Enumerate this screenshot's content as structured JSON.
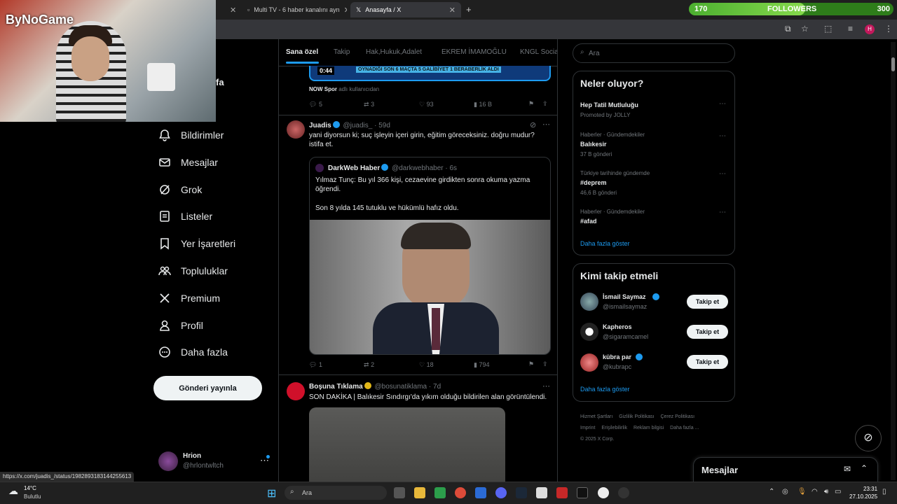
{
  "browser": {
    "tabs": [
      {
        "label": ""
      },
      {
        "label": "Multi TV - 6 haber kanalını ayn"
      },
      {
        "label": "Anasayfa / X"
      }
    ],
    "status_url": "https://x.com/juadis_/status/1982893183144255613"
  },
  "overlay": {
    "logo": "ByNoGame",
    "followers": {
      "current": "170",
      "label": "FOLLOWERS",
      "goal": "300",
      "progress": 0.57
    }
  },
  "nav": {
    "items": [
      {
        "label": "Bildirimler",
        "icon": "bell-icon"
      },
      {
        "label": "Mesajlar",
        "icon": "mail-icon"
      },
      {
        "label": "Grok",
        "icon": "grok-icon"
      },
      {
        "label": "Listeler",
        "icon": "list-icon"
      },
      {
        "label": "Yer İşaretleri",
        "icon": "bookmark-icon"
      },
      {
        "label": "Topluluklar",
        "icon": "people-icon"
      },
      {
        "label": "Premium",
        "icon": "x-logo-icon"
      },
      {
        "label": "Profil",
        "icon": "person-icon"
      },
      {
        "label": "Daha fazla",
        "icon": "more-circle-icon"
      }
    ],
    "partial_label": "fa",
    "post_button": "Gönderi yayınla",
    "account": {
      "name": "Hrion",
      "handle": "@hrlontwltch"
    }
  },
  "center": {
    "tabs": [
      "Sana özel",
      "Takip",
      "Hak,Hukuk,Adalet",
      "EKREM İMAMOĞLU",
      "KNGL Socia"
    ],
    "video": {
      "time": "0:44",
      "banner": "OYNADIĞI SON 6 MAÇTA 5 GALİBİYET 1 BERABERLİK ALDI"
    },
    "tweet0": {
      "source_name": "NOW Spor",
      "source_suffix": "adlı kullanıcıdan",
      "replies": "5",
      "reposts": "3",
      "likes": "93",
      "views": "16 B"
    },
    "tweet1": {
      "name": "Juadis",
      "handle": "@juadis_",
      "time": "· 59d",
      "text": "yani diyorsun ki; suç işleyin içeri girin, eğitim göreceksiniz. doğru mudur? istifa et.",
      "quote": {
        "name": "DarkWeb Haber",
        "handle": "@darkwebhaber",
        "time": "· 6s",
        "text1": "Yılmaz Tunç: Bu yıl 366 kişi, cezaevine girdikten sonra okuma yazma öğrendi.",
        "text2": "Son 8 yılda 145 tutuklu ve hükümlü hafız oldu."
      },
      "replies": "1",
      "reposts": "2",
      "likes": "18",
      "views": "794"
    },
    "tweet2": {
      "name": "Boşuna Tıklama",
      "handle": "@bosunatiklama",
      "time": "· 7d",
      "text": "SON DAKİKA | Balıkesir Sındırgı'da yıkım olduğu bildirilen alan görüntülendi."
    }
  },
  "right": {
    "search_placeholder": "Ara",
    "trends_title": "Neler oluyor?",
    "trends": [
      {
        "context": "",
        "title": "Hep Tatil Mutluluğu",
        "meta": "Promoted by JOLLY"
      },
      {
        "context": "Haberler · Gündemdekiler",
        "title": "Balıkesir",
        "meta": "37 B gönderi"
      },
      {
        "context": "Türkiye tarihinde gündemde",
        "title": "#deprem",
        "meta": "46,6 B gönderi"
      },
      {
        "context": "Haberler · Gündemdekiler",
        "title": "#afad",
        "meta": ""
      }
    ],
    "trends_more": "Daha fazla göster",
    "who_title": "Kimi takip etmeli",
    "who": [
      {
        "name": "İsmail Saymaz",
        "handle": "@ismailsaymaz",
        "button": "Takip et"
      },
      {
        "name": "Kapheros",
        "handle": "@sigaramcamel",
        "button": "Takip et"
      },
      {
        "name": "kübra par",
        "handle": "@kubrapc",
        "button": "Takip et"
      }
    ],
    "who_more": "Daha fazla göster",
    "footer": [
      "Hizmet Şartları",
      "Gizlilik Politikası",
      "Çerez Politikası",
      "Imprint",
      "Erişilebilirlik",
      "Reklam bilgisi",
      "Daha fazla ...",
      "© 2025 X Corp."
    ],
    "messages_label": "Mesajlar"
  },
  "taskbar": {
    "weather_temp": "14°C",
    "weather_desc": "Bulutlu",
    "search": "Ara",
    "time": "23:31",
    "date": "27.10.2025"
  },
  "colors": {
    "accent": "#1d9bf0",
    "bg": "#000000",
    "border": "#2f3336",
    "muted": "#71767b"
  }
}
